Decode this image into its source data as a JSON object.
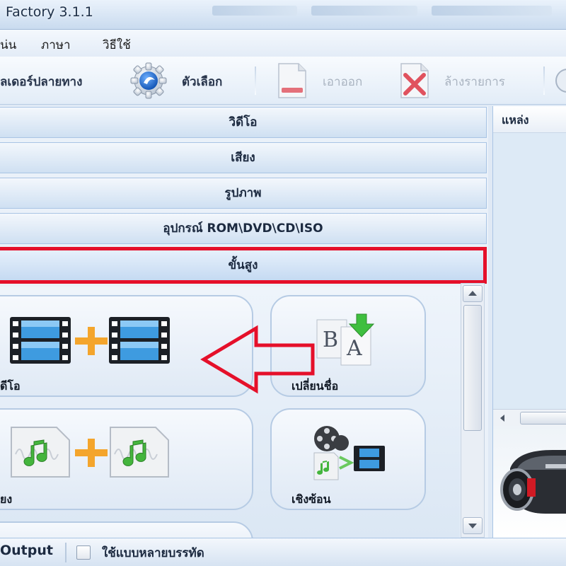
{
  "window": {
    "title": "Factory 3.1.1"
  },
  "menu": {
    "items": [
      "น่น",
      "ภาษา",
      "วิธีใช้"
    ]
  },
  "toolbar": {
    "output_folder": "ลเดอร์ปลายทาง",
    "options": "ตัวเลือก",
    "remove": "เอาออก",
    "clear_list": "ล้างรายการ"
  },
  "categories": [
    {
      "label": "วิดีโอ"
    },
    {
      "label": "เสียง"
    },
    {
      "label": "รูปภาพ"
    },
    {
      "label": "อุปกรณ์ ROM\\DVD\\CD\\ISO"
    },
    {
      "label": "ขั้นสูง"
    }
  ],
  "tiles": {
    "video_join": "ดีโอ",
    "rename": "เปลี่ยนชื่อ",
    "audio_join": "ยง",
    "mux": "เชิงซ้อน"
  },
  "right_panel": {
    "header": "แหล่ง"
  },
  "statusbar": {
    "output": "Output",
    "multithread": "ใช้แบบหลายบรรทัด"
  },
  "colors": {
    "highlight": "#e5102a",
    "accent": "#3a79c7"
  }
}
